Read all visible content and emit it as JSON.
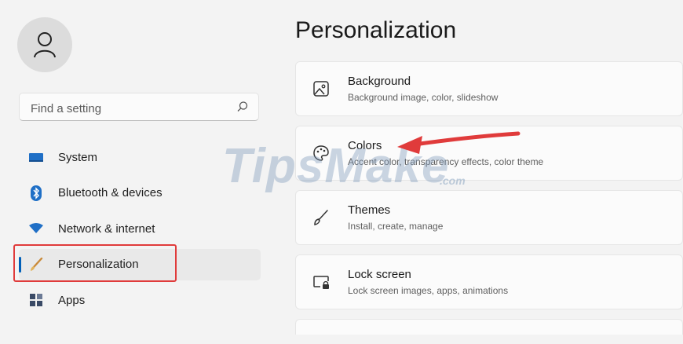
{
  "sidebar": {
    "search": {
      "placeholder": "Find a setting",
      "icon": "search-icon"
    },
    "items": [
      {
        "label": "System",
        "icon": "system-icon",
        "icon_color": "#1f6fc6"
      },
      {
        "label": "Bluetooth & devices",
        "icon": "bluetooth-icon",
        "icon_color": "#1f6fc6"
      },
      {
        "label": "Network & internet",
        "icon": "wifi-icon",
        "icon_color": "#1f6fc6"
      },
      {
        "label": "Personalization",
        "icon": "brush-icon",
        "icon_color": "#c98a3a",
        "selected": true
      },
      {
        "label": "Apps",
        "icon": "apps-icon",
        "icon_color": "#3a4a66"
      }
    ]
  },
  "main": {
    "title": "Personalization",
    "cards": [
      {
        "title": "Background",
        "subtitle": "Background image, color, slideshow",
        "icon": "image-icon"
      },
      {
        "title": "Colors",
        "subtitle": "Accent color, transparency effects, color theme",
        "icon": "palette-icon"
      },
      {
        "title": "Themes",
        "subtitle": "Install, create, manage",
        "icon": "brush-icon"
      },
      {
        "title": "Lock screen",
        "subtitle": "Lock screen images, apps, animations",
        "icon": "lock-screen-icon"
      }
    ]
  },
  "watermark": {
    "text": "TipsMake",
    "suffix": ".com"
  },
  "colors": {
    "accent": "#005fb8",
    "annotation": "#e03b3b"
  }
}
